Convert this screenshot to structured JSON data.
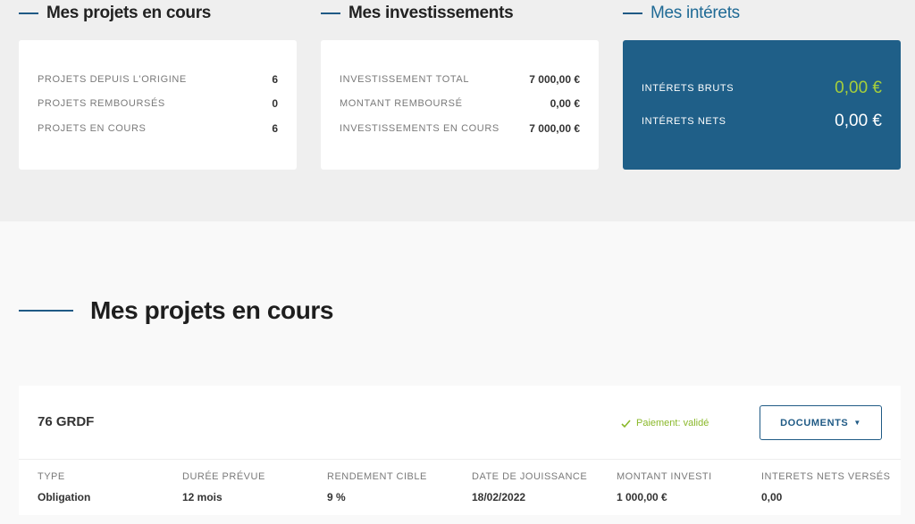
{
  "sections": {
    "projects": {
      "title": "Mes projets en cours",
      "rows": [
        {
          "label": "PROJETS DEPUIS L'ORIGINE",
          "value": "6"
        },
        {
          "label": "PROJETS REMBOURSÉS",
          "value": "0"
        },
        {
          "label": "PROJETS EN COURS",
          "value": "6"
        }
      ]
    },
    "investments": {
      "title": "Mes investissements",
      "rows": [
        {
          "label": "INVESTISSEMENT TOTAL",
          "value": "7 000,00 €"
        },
        {
          "label": "MONTANT REMBOURSÉ",
          "value": "0,00 €"
        },
        {
          "label": "INVESTISSEMENTS EN COURS",
          "value": "7 000,00 €"
        }
      ]
    },
    "interests": {
      "title": "Mes intérets",
      "rows": [
        {
          "label": "INTÉRETS BRUTS",
          "value": "0,00 €"
        },
        {
          "label": "INTÉRETS NETS",
          "value": "0,00 €"
        }
      ]
    }
  },
  "current_projects": {
    "title": "Mes projets en cours",
    "items": [
      {
        "name": "76 GRDF",
        "status": "Paiement: validé",
        "documents_label": "DOCUMENTS",
        "columns": [
          {
            "header": "TYPE",
            "value": "Obligation"
          },
          {
            "header": "DURÉE PRÉVUE",
            "value": "12 mois"
          },
          {
            "header": "RENDEMENT CIBLE",
            "value": "9 %"
          },
          {
            "header": "DATE DE JOUISSANCE",
            "value": "18/02/2022"
          },
          {
            "header": "MONTANT INVESTI",
            "value": "1 000,00 €"
          },
          {
            "header": "INTERETS NETS VERSÉS",
            "value": "0,00"
          }
        ]
      }
    ]
  },
  "colors": {
    "accent": "#1f5a85",
    "interest_card": "#1f5f88",
    "positive": "#a6cf3b",
    "status_ok": "#8ab82a"
  },
  "icons": {
    "status": "check-icon",
    "documents": "caret-down-icon"
  }
}
